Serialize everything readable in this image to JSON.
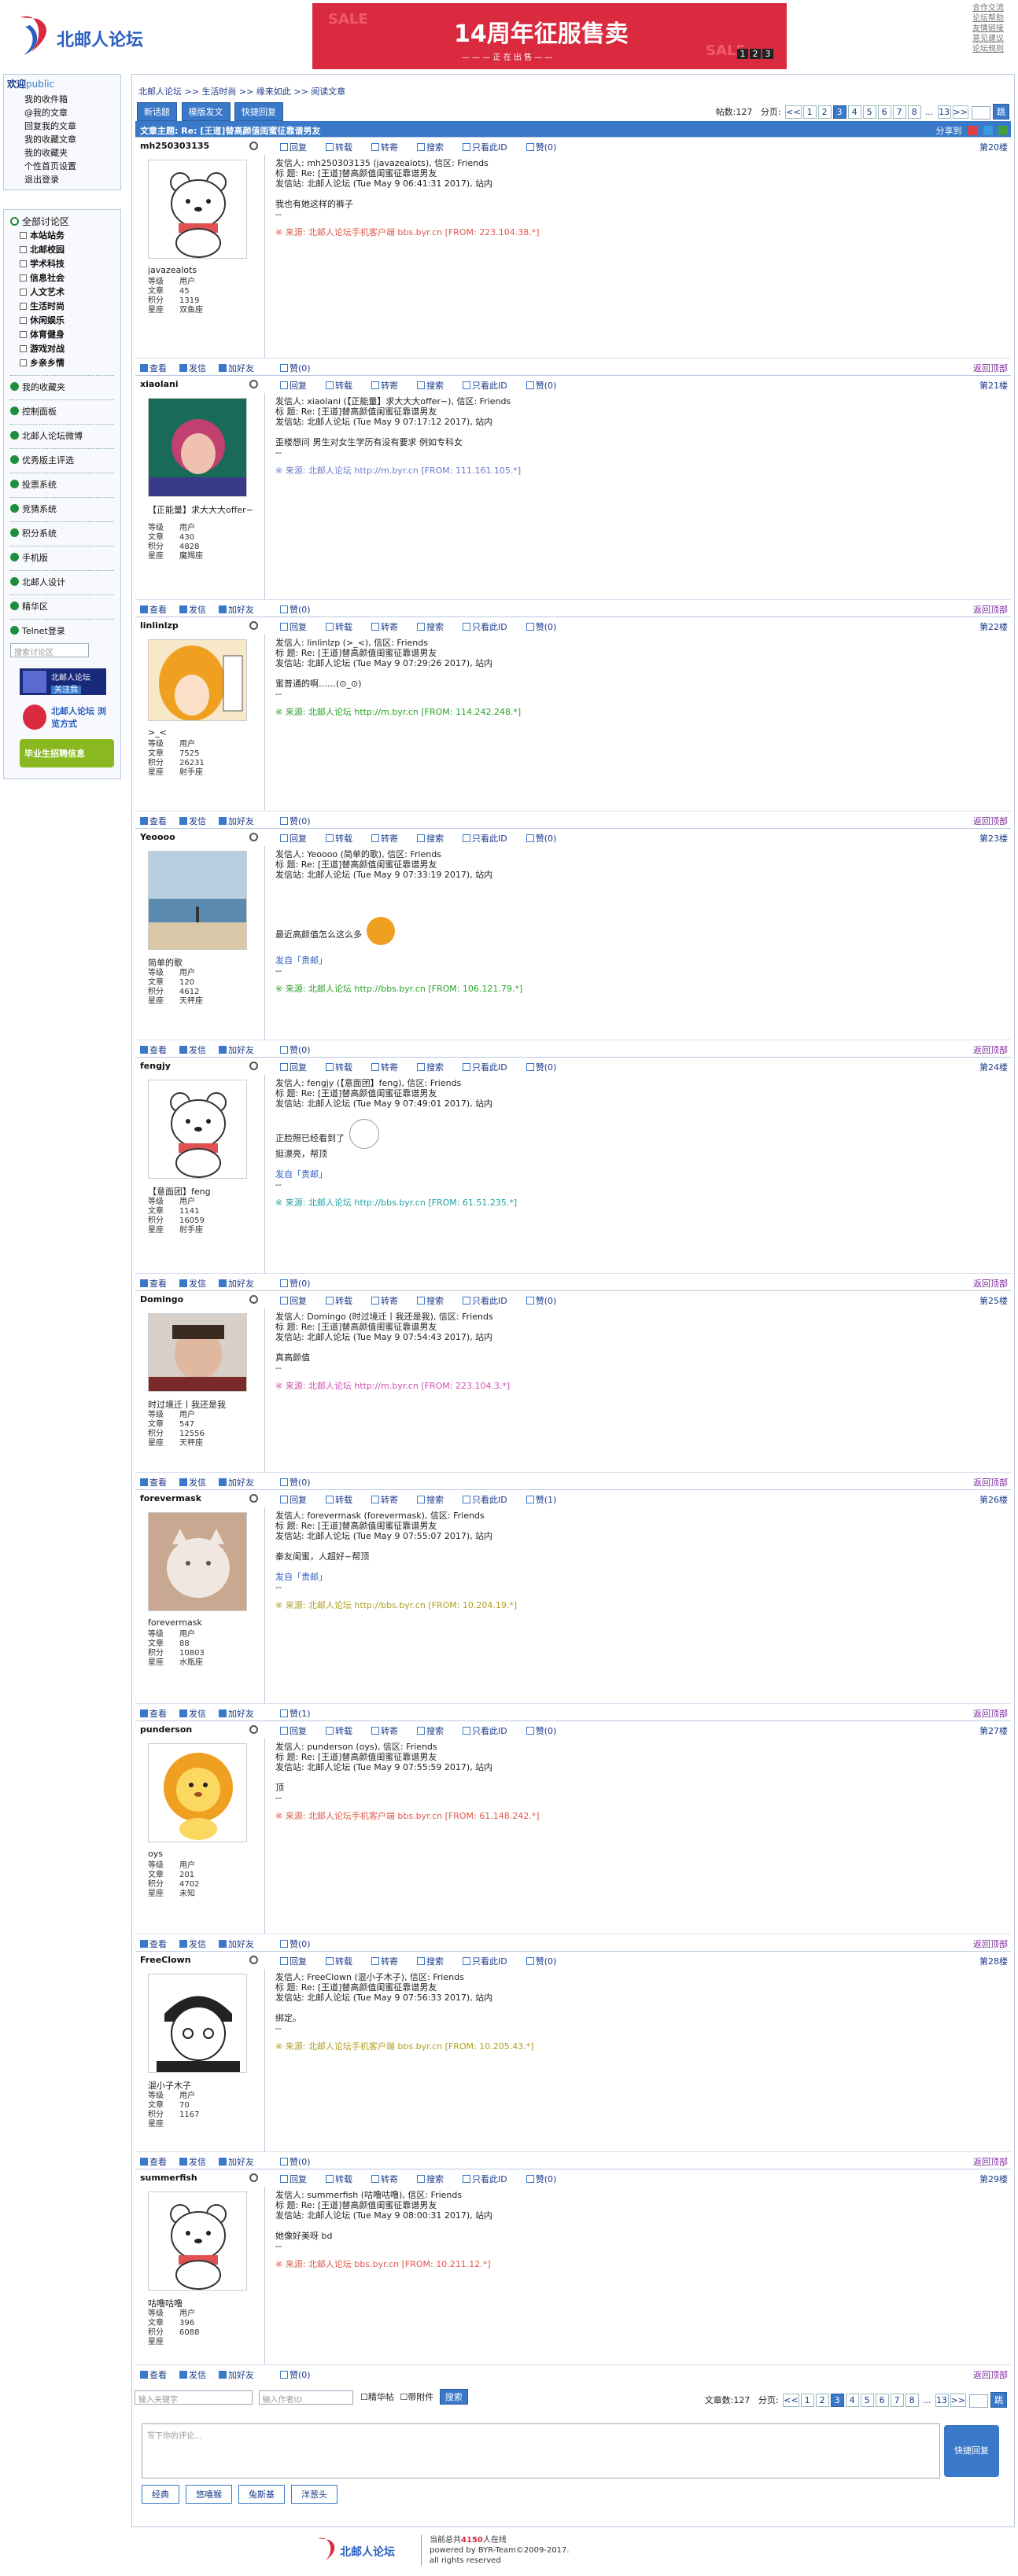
{
  "header": {
    "logo_text": "北邮人论坛",
    "banner_text": "14周年征服售卖",
    "banner_watermark": "SALE",
    "banner_sub": "— — — 正 在 出 售 — —",
    "banner_days": [
      "1",
      "2",
      "3"
    ],
    "top_links": [
      "合作交流",
      "论坛帮助",
      "友情链接",
      "意见建议",
      "论坛规则"
    ]
  },
  "sidebar": {
    "welcome": "欢迎",
    "user": "public",
    "user_links": [
      "我的收件箱",
      "@我的文章",
      "回复我的文章",
      "我的收藏文章",
      "我的收藏夹",
      "个性首页设置",
      "退出登录"
    ],
    "all_sections": "全部讨论区",
    "sections": [
      "本站站务",
      "北邮校园",
      "学术科技",
      "信息社会",
      "人文艺术",
      "生活时尚",
      "休闲娱乐",
      "体育健身",
      "游戏对战",
      "乡亲乡情"
    ],
    "items": [
      "我的收藏夹",
      "控制面板",
      "北邮人论坛微博",
      "优秀版主评选",
      "投票系统",
      "竞猜系统",
      "积分系统",
      "手机版",
      "北邮人设计",
      "精华区",
      "Telnet登录"
    ],
    "search_placeholder": "搜索讨论区",
    "ad1": "北邮人论坛",
    "ad1_sub": "关注我",
    "ad2": "北邮人论坛 浏览方式",
    "ad3": "毕业生招聘信息"
  },
  "main": {
    "breadcrumb": [
      "北邮人论坛",
      ">>",
      "生活时尚",
      ">>",
      "缘来如此",
      ">>",
      "阅读文章"
    ],
    "buttons": [
      "新话题",
      "模版发文",
      "快捷回复"
    ],
    "post_count_label": "帖数:",
    "post_count": "127",
    "pages_label": "分页:",
    "pages": [
      "<<",
      "1",
      "2",
      "3",
      "4",
      "5",
      "6",
      "7",
      "8",
      "...",
      "13",
      ">>"
    ],
    "current_page": "3",
    "subject": "文章主题: Re: [王道]替高颜值闺蜜征靠谱男友",
    "share": "分享到",
    "ops": [
      "回复",
      "转载",
      "转寄",
      "搜索",
      "只看此ID",
      "赞(0)"
    ],
    "foot_ops": [
      "查看",
      "发信",
      "加好友"
    ],
    "back_top": "返回顶部",
    "stat_labels": [
      "等级",
      "文章",
      "积分",
      "星座"
    ]
  },
  "posts": [
    {
      "user": "mh250303135",
      "nick": "javazealots",
      "level": "用户",
      "articles": "45",
      "score": "1319",
      "star": "双鱼座",
      "floor": "第20楼",
      "like": "赞(0)",
      "l1": "发信人: mh250303135 (javazealots), 信区: Friends",
      "l2": "标  题: Re: [王道]替高颜值闺蜜征靠谱男友",
      "l3": "发信站: 北邮人论坛 (Tue May  9 06:41:31 2017), 站内",
      "text": "我也有她这样的裤子",
      "text2": "",
      "sig": "",
      "dash": "--",
      "src": "※ 来源: 北邮人论坛手机客户端 bbs.byr.cn [FROM: 223.104.38.*]",
      "srcColor": "#e0584a",
      "av": "bear"
    },
    {
      "user": "xiaolani",
      "nick": "【正能量】求大大大offer~",
      "level": "用户",
      "articles": "430",
      "score": "4828",
      "star": "魔羯座",
      "floor": "第21楼",
      "like": "赞(0)",
      "l1": "发信人: xiaolani (【正能量】求大大大offer~), 信区: Friends",
      "l2": "标  题: Re: [王道]替高颜值闺蜜征靠谱男友",
      "l3": "发信站: 北邮人论坛 (Tue May  9 07:17:12 2017), 站内",
      "text": "歪楼想问 男生对女生学历有没有要求 例如专科女",
      "text2": "",
      "sig": "",
      "dash": "--",
      "src": "※ 来源: 北邮人论坛 http://m.byr.cn [FROM: 111.161.105.*]",
      "srcColor": "#6a7ad0",
      "av": "girl"
    },
    {
      "user": "linlinlzp",
      "nick": ">_<",
      "level": "用户",
      "articles": "7525",
      "score": "26231",
      "star": "射手座",
      "floor": "第22楼",
      "like": "赞(0)",
      "l1": "发信人: linlinlzp (>_<), 信区: Friends",
      "l2": "标  题: Re: [王道]替高颜值闺蜜征靠谱男友",
      "l3": "发信站: 北邮人论坛 (Tue May  9 07:29:26 2017), 站内",
      "text": "蜜普通的啊……(⊙_⊙)",
      "text2": "",
      "sig": "",
      "dash": "--",
      "src": "※ 来源: 北邮人论坛 http://m.byr.cn [FROM: 114.242.248.*]",
      "srcColor": "#29a329",
      "av": "anime"
    },
    {
      "user": "Yeoooo",
      "nick": "简单的歌",
      "level": "用户",
      "articles": "120",
      "score": "4612",
      "star": "天秤座",
      "floor": "第23楼",
      "like": "赞(0)",
      "l1": "发信人: Yeoooo (简单的歌), 信区: Friends",
      "l2": "标  题: Re: [王道]替高颜值闺蜜征靠谱男友",
      "l3": "发信站: 北邮人论坛 (Tue May  9 07:33:19 2017), 站内",
      "text": "最近高颜值怎么这么多",
      "text2": "",
      "sig": "发自「贵邮」",
      "dash": "--",
      "src": "※ 来源: 北邮人论坛 http://bbs.byr.cn [FROM: 106.121.79.*]",
      "srcColor": "#29a329",
      "av": "sea"
    },
    {
      "user": "fengjy",
      "nick": "【意面团】feng",
      "level": "用户",
      "articles": "1141",
      "score": "16059",
      "star": "射手座",
      "floor": "第24楼",
      "like": "赞(0)",
      "l1": "发信人: fengjy (【意面团】feng), 信区: Friends",
      "l2": "标  题: Re: [王道]替高颜值闺蜜征靠谱男友",
      "l3": "发信站: 北邮人论坛 (Tue May  9 07:49:01 2017), 站内",
      "text": "正脸照已经看到了",
      "text2": "挺漂亮，帮顶",
      "sig": "发自「贵邮」",
      "dash": "--",
      "src": "※ 来源: 北邮人论坛 http://bbs.byr.cn [FROM: 61.51.235.*]",
      "srcColor": "#1aa3a3",
      "av": "bear"
    },
    {
      "user": "Domingo",
      "nick": "时过境迁丨我还是我",
      "level": "用户",
      "articles": "547",
      "score": "12556",
      "star": "天秤座",
      "floor": "第25楼",
      "like": "赞(0)",
      "l1": "发信人: Domingo (时过境迁丨我还是我), 信区: Friends",
      "l2": "标  题: Re: [王道]替高颜值闺蜜征靠谱男友",
      "l3": "发信站: 北邮人论坛 (Tue May  9 07:54:43 2017), 站内",
      "text": "真高颜值",
      "text2": "",
      "sig": "",
      "dash": "--",
      "src": "※ 来源: 北邮人论坛 http://m.byr.cn [FROM: 223.104.3.*]",
      "srcColor": "#d050b0",
      "av": "man"
    },
    {
      "user": "forevermask",
      "nick": "forevermask",
      "level": "用户",
      "articles": "88",
      "score": "10803",
      "star": "水瓶座",
      "floor": "第26楼",
      "like": "赞(1)",
      "l1": "发信人: forevermask (forevermask), 信区: Friends",
      "l2": "标  题: Re: [王道]替高颜值闺蜜征靠谱男友",
      "l3": "发信站: 北邮人论坛 (Tue May  9 07:55:07 2017), 站内",
      "text": "秦友闺蜜，人超好~帮顶",
      "text2": "",
      "sig": "发自「贵邮」",
      "dash": "--",
      "src": "※ 来源: 北邮人论坛 http://bbs.byr.cn [FROM: 10.204.19.*]",
      "srcColor": "#b0a020",
      "av": "cat"
    },
    {
      "user": "punderson",
      "nick": "oys",
      "level": "用户",
      "articles": "201",
      "score": "4702",
      "star": "未知",
      "floor": "第27楼",
      "like": "赞(0)",
      "l1": "发信人: punderson (oys), 信区: Friends",
      "l2": "标  题: Re: [王道]替高颜值闺蜜征靠谱男友",
      "l3": "发信站: 北邮人论坛 (Tue May  9 07:55:59 2017), 站内",
      "text": "顶",
      "text2": "",
      "sig": "",
      "dash": "--",
      "src": "※ 来源: 北邮人论坛手机客户端 bbs.byr.cn [FROM: 61.148.242.*]",
      "srcColor": "#e0584a",
      "av": "lion"
    },
    {
      "user": "FreeClown",
      "nick": "混小子木子",
      "level": "用户",
      "articles": "70",
      "score": "1167",
      "star": "",
      "floor": "第28楼",
      "like": "赞(0)",
      "l1": "发信人: FreeClown (混小子木子), 信区: Friends",
      "l2": "标  题: Re: [王道]替高颜值闺蜜征靠谱男友",
      "l3": "发信站: 北邮人论坛 (Tue May  9 07:56:33 2017), 站内",
      "text": "绑定。",
      "text2": "",
      "sig": "",
      "dash": "--",
      "src": "※ 来源: 北邮人论坛手机客户端 bbs.byr.cn [FROM: 10.205.43.*]",
      "srcColor": "#b0a020",
      "av": "sketch"
    },
    {
      "user": "summerfish",
      "nick": "咕噜咕噜",
      "level": "用户",
      "articles": "396",
      "score": "6088",
      "star": "",
      "floor": "第29楼",
      "like": "赞(0)",
      "l1": "发信人: summerfish (咕噜咕噜), 信区: Friends",
      "l2": "标  题: Re: [王道]替高颜值闺蜜征靠谱男友",
      "l3": "发信站: 北邮人论坛 (Tue May  9 08:00:31 2017), 站内",
      "text": "她像好美呀 bd",
      "text2": "",
      "sig": "",
      "dash": "--",
      "src": "※ 来源: 北邮人论坛 bbs.byr.cn [FROM: 10.211.12.*]",
      "srcColor": "#e0584a",
      "av": "bear"
    }
  ],
  "bottom": {
    "kw_placeholder": "输入关键字",
    "author_placeholder": "输入作者ID",
    "check1": "精华帖",
    "check2": "带附件",
    "search": "搜索",
    "count_label": "文章数:",
    "count": "127",
    "pages_label": "分页:",
    "reply_placeholder": "写下你的评论...",
    "reply_btn": "快捷回复",
    "emo_tabs": [
      "经典",
      "悠嘻猴",
      "兔斯基",
      "洋葱头"
    ]
  },
  "footer": {
    "online_pre": "当前总共",
    "online_num": "4150",
    "online_post": "人在线",
    "powered": "powered by BYR-Team©2009-2017.",
    "rights": "all rights reserved",
    "logo_text": "北邮人论坛"
  }
}
